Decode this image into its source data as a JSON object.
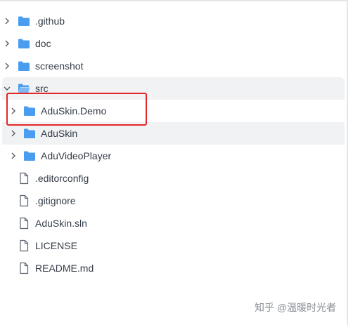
{
  "colors": {
    "folder": "#4a9cf0",
    "file_outline": "#5c6370",
    "text": "#333c47",
    "highlight": "#e52626",
    "selected_bg": "#f1f2f4"
  },
  "tree": {
    "items": [
      {
        "label": ".github",
        "type": "folder",
        "expanded": false,
        "icon": "folder-icon"
      },
      {
        "label": "doc",
        "type": "folder",
        "expanded": false,
        "icon": "folder-icon"
      },
      {
        "label": "screenshot",
        "type": "folder",
        "expanded": false,
        "icon": "folder-icon"
      },
      {
        "label": "src",
        "type": "folder",
        "expanded": true,
        "icon": "folder-open-icon"
      }
    ],
    "src_children": [
      {
        "label": "AduSkin.Demo",
        "type": "folder",
        "icon": "folder-icon"
      },
      {
        "label": "AduSkin",
        "type": "folder",
        "icon": "folder-icon"
      },
      {
        "label": "AduVideoPlayer",
        "type": "folder",
        "icon": "folder-icon"
      }
    ],
    "files": [
      {
        "label": ".editorconfig",
        "icon": "file-icon"
      },
      {
        "label": ".gitignore",
        "icon": "file-icon"
      },
      {
        "label": "AduSkin.sln",
        "icon": "file-icon"
      },
      {
        "label": "LICENSE",
        "icon": "file-icon"
      },
      {
        "label": "README.md",
        "icon": "file-icon"
      }
    ]
  },
  "watermark": {
    "text": "知乎 @温暖时光者"
  }
}
